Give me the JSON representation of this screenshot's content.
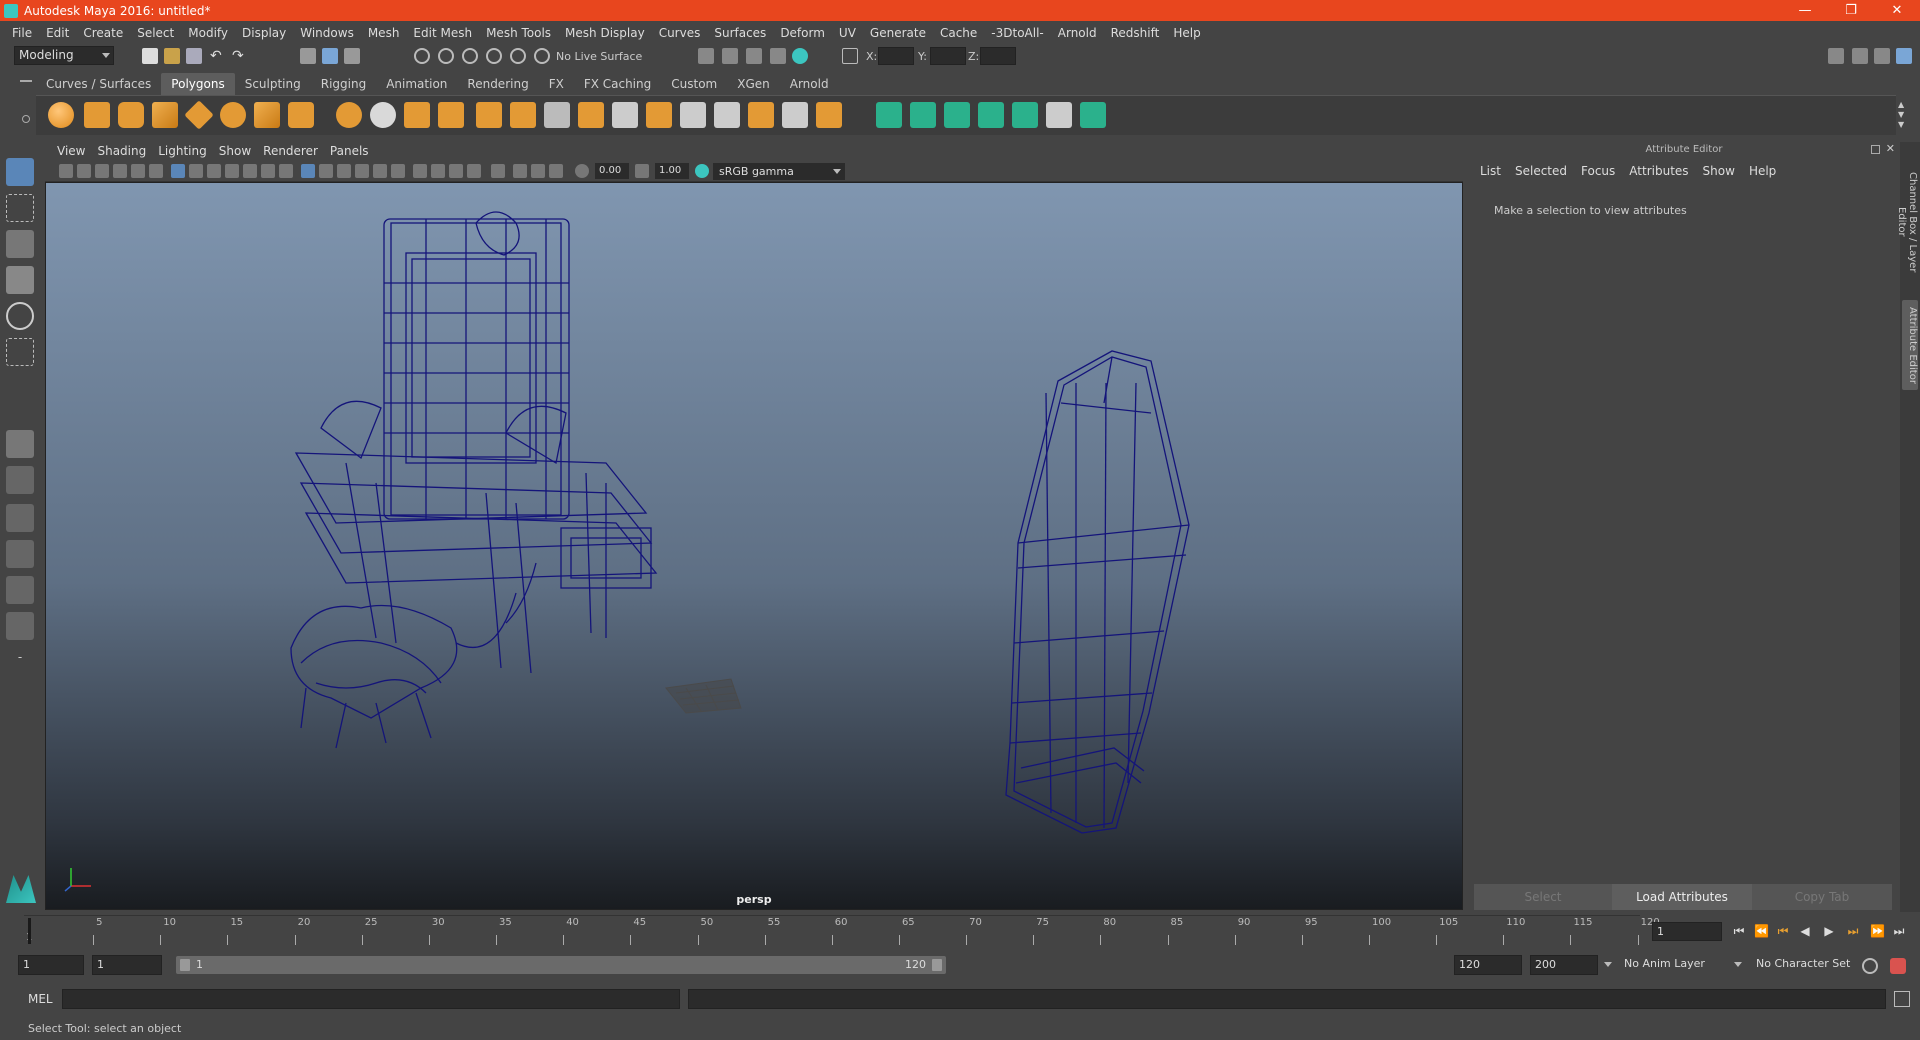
{
  "window": {
    "title": "Autodesk Maya 2016: untitled*"
  },
  "menubar": [
    "File",
    "Edit",
    "Create",
    "Select",
    "Modify",
    "Display",
    "Windows",
    "Mesh",
    "Edit Mesh",
    "Mesh Tools",
    "Mesh Display",
    "Curves",
    "Surfaces",
    "Deform",
    "UV",
    "Generate",
    "Cache",
    "-3DtoAll-",
    "Arnold",
    "Redshift",
    "Help"
  ],
  "statusline": {
    "mode_menu": "Modeling",
    "live_surface": "No Live Surface",
    "x_label": "X:",
    "y_label": "Y:",
    "z_label": "Z:"
  },
  "shelf": {
    "tabs": [
      "Curves / Surfaces",
      "Polygons",
      "Sculpting",
      "Rigging",
      "Animation",
      "Rendering",
      "FX",
      "FX Caching",
      "Custom",
      "XGen",
      "Arnold"
    ],
    "active_tab": "Polygons"
  },
  "panel": {
    "menus": [
      "View",
      "Shading",
      "Lighting",
      "Show",
      "Renderer",
      "Panels"
    ],
    "exposure": "0.00",
    "gamma": "1.00",
    "color_space": "sRGB gamma",
    "camera": "persp"
  },
  "attribute_editor": {
    "header": "Attribute Editor",
    "menus": [
      "List",
      "Selected",
      "Focus",
      "Attributes",
      "Show",
      "Help"
    ],
    "message": "Make a selection to view attributes",
    "buttons": {
      "select": "Select",
      "load": "Load Attributes",
      "copy": "Copy Tab"
    }
  },
  "side_tabs": [
    "Channel Box / Layer Editor",
    "Attribute Editor"
  ],
  "timeslider": {
    "start_label": "1",
    "labels": [
      "5",
      "10",
      "15",
      "20",
      "25",
      "30",
      "35",
      "40",
      "45",
      "50",
      "55",
      "60",
      "65",
      "70",
      "75",
      "80",
      "85",
      "90",
      "95",
      "100",
      "105",
      "110",
      "115",
      "120"
    ],
    "current_frame": "1"
  },
  "range": {
    "start": "1",
    "playback_start": "1",
    "slider_start": "1",
    "slider_end": "120",
    "playback_end": "120",
    "end": "200",
    "anim_layer": "No Anim Layer",
    "character_set": "No Character Set"
  },
  "cmdline": {
    "label": "MEL"
  },
  "helpline": {
    "text": "Select Tool: select an object"
  },
  "colors": {
    "titlebar": "#e8461e",
    "wireframe": "#14147a",
    "accent": "#3cc6c0"
  }
}
